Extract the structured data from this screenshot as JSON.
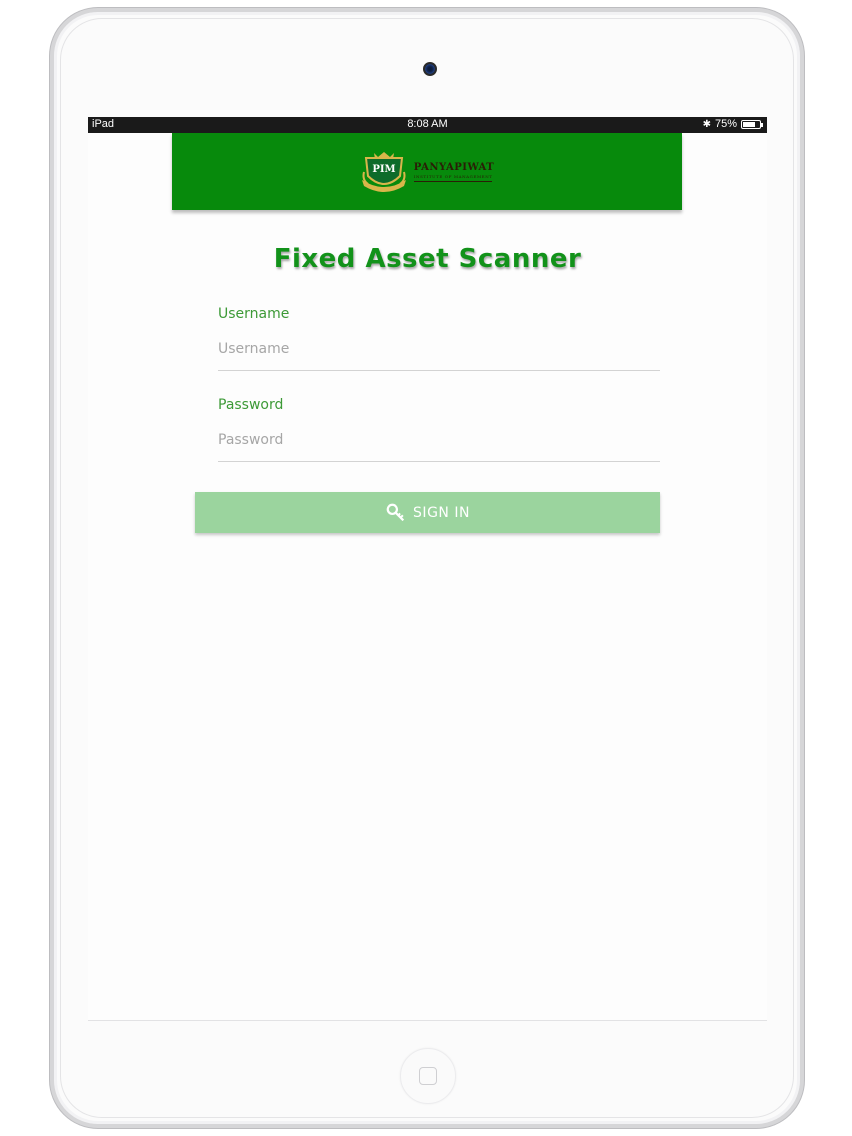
{
  "device": {
    "camera_icon": "camera-icon",
    "home_button_icon": "home-button-icon"
  },
  "status_bar": {
    "device": "iPad",
    "time": "8:08 AM",
    "battery": "75%",
    "battery_level": 0.75,
    "bluetooth_icon": "bluetooth-icon"
  },
  "header": {
    "background_color": "#078a0c",
    "logo": {
      "crest_text": "PIM",
      "name": "PANYAPIWAT",
      "subtitle": "INSTITUTE OF MANAGEMENT"
    }
  },
  "app": {
    "title": "Fixed Asset Scanner",
    "accent_color": "#12921a"
  },
  "login_form": {
    "username_label": "Username",
    "username_placeholder": "Username",
    "username_value": "",
    "password_label": "Password",
    "password_placeholder": "Password",
    "password_value": "",
    "signin_label": "SIGN IN",
    "signin_icon": "key-icon",
    "signin_color": "#9bd49e"
  }
}
